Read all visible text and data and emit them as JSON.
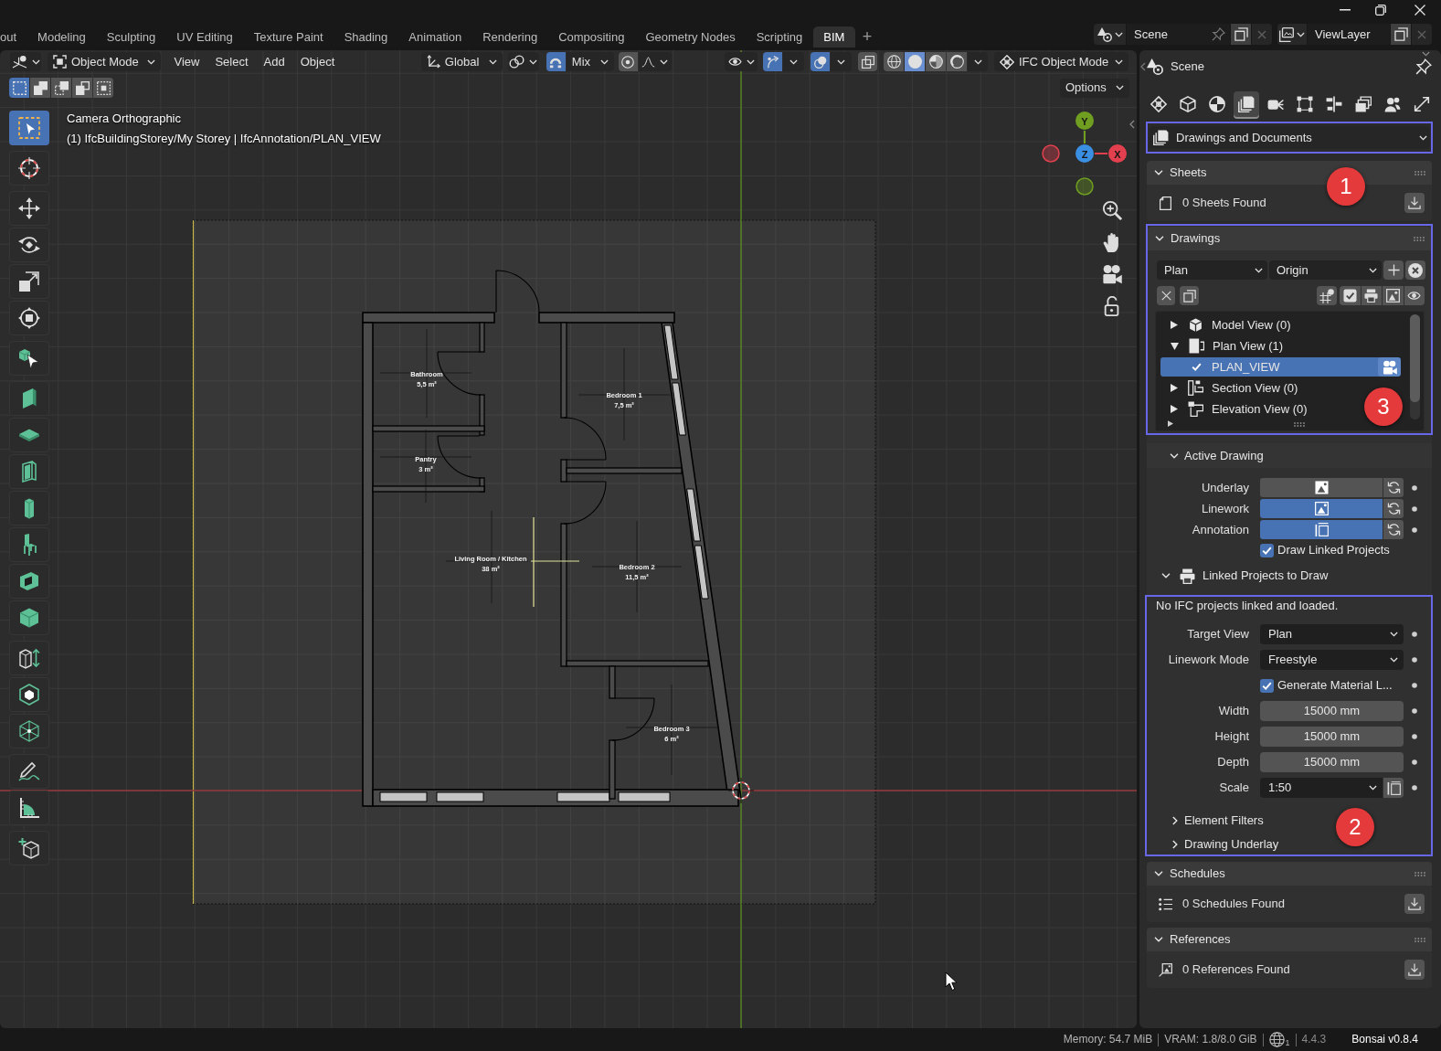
{
  "workspace_tabs": [
    {
      "label": "out",
      "selected": false
    },
    {
      "label": "Modeling",
      "selected": false
    },
    {
      "label": "Sculpting",
      "selected": false
    },
    {
      "label": "UV Editing",
      "selected": false
    },
    {
      "label": "Texture Paint",
      "selected": false
    },
    {
      "label": "Shading",
      "selected": false
    },
    {
      "label": "Animation",
      "selected": false
    },
    {
      "label": "Rendering",
      "selected": false
    },
    {
      "label": "Compositing",
      "selected": false
    },
    {
      "label": "Geometry Nodes",
      "selected": false
    },
    {
      "label": "Scripting",
      "selected": false
    },
    {
      "label": "BIM",
      "selected": true
    }
  ],
  "add_workspace": "+",
  "scene": "Scene",
  "view_layer": "ViewLayer",
  "viewport": {
    "mode": "Object Mode",
    "menus": [
      "View",
      "Select",
      "Add",
      "Object"
    ],
    "orientation": "Global",
    "snapping": {
      "on": true,
      "target": "Mix"
    },
    "proportional_editing": {
      "on": false
    },
    "gizmos": {
      "on": true
    },
    "overlays": {
      "on": true
    },
    "xray": {
      "on": false
    },
    "shading_modes": [
      {
        "kind": "wireframe",
        "selected": false
      },
      {
        "kind": "solid",
        "selected": true
      },
      {
        "kind": "material",
        "selected": false
      },
      {
        "kind": "rendered",
        "selected": false
      }
    ],
    "ifc_mode": "IFC Object Mode",
    "selection_modes": [
      {
        "kind": "set",
        "selected": true
      },
      {
        "kind": "extend",
        "selected": false
      },
      {
        "kind": "subtract",
        "selected": false
      },
      {
        "kind": "invert",
        "selected": false
      },
      {
        "kind": "intersect",
        "selected": false
      }
    ],
    "options": "Options",
    "tool_groups": [
      [
        {
          "kind": "select-box",
          "selected": true
        }
      ],
      [
        {
          "kind": "cursor",
          "selected": false
        }
      ],
      [
        {
          "kind": "move",
          "selected": false
        },
        {
          "kind": "rotate",
          "selected": false
        },
        {
          "kind": "scale",
          "selected": false
        },
        {
          "kind": "transform",
          "selected": false
        }
      ],
      [
        {
          "kind": "bim-select",
          "selected": false
        }
      ],
      [
        {
          "kind": "wall",
          "selected": false
        },
        {
          "kind": "slab",
          "selected": false
        },
        {
          "kind": "door",
          "selected": false
        },
        {
          "kind": "column",
          "selected": false
        },
        {
          "kind": "furniture",
          "selected": false
        },
        {
          "kind": "window",
          "selected": false
        },
        {
          "kind": "element",
          "selected": false
        }
      ],
      [
        {
          "kind": "extrude",
          "selected": false
        },
        {
          "kind": "space",
          "selected": false
        },
        {
          "kind": "structure",
          "selected": false
        }
      ],
      [
        {
          "kind": "annotate",
          "selected": false
        },
        {
          "kind": "measure",
          "selected": false
        }
      ],
      [
        {
          "kind": "add-element",
          "selected": false
        }
      ]
    ],
    "info_lines": [
      "Camera Orthographic",
      "(1) IfcBuildingStorey/My Storey | IfcAnnotation/PLAN_VIEW"
    ],
    "rooms": [
      {
        "name": "Bathroom",
        "area": "5,5 m²"
      },
      {
        "name": "Bedroom 1",
        "area": "7,5 m²"
      },
      {
        "name": "Pantry",
        "area": "3 m²"
      },
      {
        "name": "Living Room / Kitchen",
        "area": "38 m²"
      },
      {
        "name": "Bedroom 2",
        "area": "11,5 m²"
      },
      {
        "name": "Bedroom 3",
        "area": "6 m²"
      }
    ],
    "axes": [
      {
        "label": "Y",
        "color": "#6f9e21"
      },
      {
        "label": "Z",
        "color": "#3b8fe3"
      },
      {
        "label": "X",
        "color": "#e2404f"
      }
    ]
  },
  "properties": {
    "context": "Scene",
    "tabs": [
      {
        "kind": "project",
        "selected": false
      },
      {
        "kind": "object",
        "selected": false
      },
      {
        "kind": "geometry",
        "selected": false
      },
      {
        "kind": "drawings",
        "selected": true
      },
      {
        "kind": "services",
        "selected": false
      },
      {
        "kind": "structural",
        "selected": false
      },
      {
        "kind": "costing",
        "selected": false
      },
      {
        "kind": "facility",
        "selected": false
      },
      {
        "kind": "people",
        "selected": false
      },
      {
        "kind": "exchange",
        "selected": false
      }
    ],
    "category": {
      "label": "Drawings and Documents",
      "highlighted": true
    },
    "sheets": {
      "title": "Sheets",
      "expanded": true,
      "found": "0 Sheets Found",
      "callout": "1"
    },
    "drawings": {
      "title": "Drawings",
      "expanded": true,
      "highlighted": true,
      "callout": "3",
      "drawing_type": "Plan",
      "location": "Origin",
      "tree": [
        {
          "kind": "model",
          "label": "Model View (0)",
          "expanded": false
        },
        {
          "kind": "plan",
          "label": "Plan View (1)",
          "expanded": true,
          "children": [
            {
              "label": "PLAN_VIEW",
              "checked": true,
              "selected": true
            }
          ]
        },
        {
          "kind": "section",
          "label": "Section View (0)",
          "expanded": false
        },
        {
          "kind": "elevation",
          "label": "Elevation View (0)",
          "expanded": false
        }
      ],
      "active_drawing": {
        "title": "Active Drawing",
        "expanded": true,
        "layers": [
          {
            "kind": "underlay",
            "label": "Underlay",
            "on": false
          },
          {
            "kind": "linework",
            "label": "Linework",
            "on": true
          },
          {
            "kind": "annotation",
            "label": "Annotation",
            "on": true
          }
        ],
        "draw_linked": {
          "label": "Draw Linked Projects",
          "checked": true
        }
      },
      "linked_projects": {
        "title": "Linked Projects to Draw",
        "expanded": true,
        "highlighted": true,
        "callout": "2",
        "message": "No IFC projects linked and loaded.",
        "fields": [
          {
            "kind": "dropdown",
            "label": "Target View",
            "value": "Plan"
          },
          {
            "kind": "dropdown",
            "label": "Linework Mode",
            "value": "Freestyle"
          },
          {
            "kind": "checkbox",
            "label": "Generate Material L...",
            "checked": true
          },
          {
            "kind": "number",
            "label": "Width",
            "value": "15000 mm"
          },
          {
            "kind": "number",
            "label": "Height",
            "value": "15000 mm"
          },
          {
            "kind": "number",
            "label": "Depth",
            "value": "15000 mm"
          },
          {
            "kind": "scale",
            "label": "Scale",
            "value": "1:50"
          }
        ],
        "subpanels": [
          {
            "title": "Element Filters",
            "expanded": false
          },
          {
            "title": "Drawing Underlay",
            "expanded": false
          }
        ]
      }
    },
    "schedules": {
      "title": "Schedules",
      "expanded": true,
      "found": "0 Schedules Found"
    },
    "references": {
      "title": "References",
      "expanded": true,
      "found": "0 References Found"
    }
  },
  "status_bar": {
    "memory": "Memory: 54.7 MiB",
    "vram": "VRAM: 1.8/8.0 GiB",
    "network_badge": "1",
    "version": "4.4.3",
    "addon": "Bonsai v0.8.4"
  }
}
